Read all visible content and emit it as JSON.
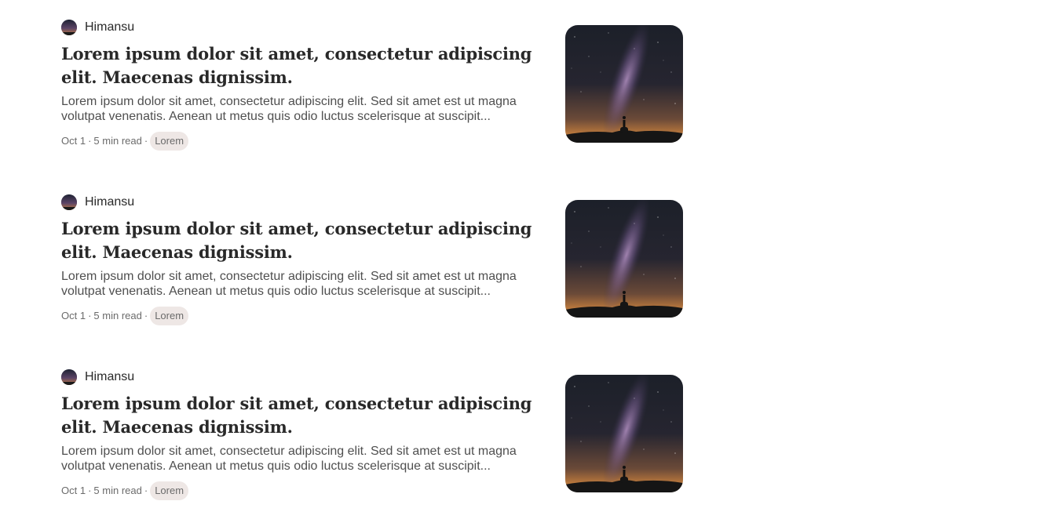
{
  "posts": [
    {
      "author": "Himansu",
      "title": "Lorem ipsum dolor sit amet, consectetur adipiscing elit. Maecenas dignissim.",
      "excerpt": "Lorem ipsum dolor sit amet, consectetur adipiscing elit. Sed sit amet est ut magna volutpat venenatis. Aenean ut metus quis odio luctus scelerisque at suscipit...",
      "date": "Oct 1",
      "read_time": "5 min read",
      "separator": "·",
      "tag": "Lorem",
      "thumbnail_icon": "milky-way-night-sky-image"
    },
    {
      "author": "Himansu",
      "title": "Lorem ipsum dolor sit amet, consectetur adipiscing elit. Maecenas dignissim.",
      "excerpt": "Lorem ipsum dolor sit amet, consectetur adipiscing elit. Sed sit amet est ut magna volutpat venenatis. Aenean ut metus quis odio luctus scelerisque at suscipit...",
      "date": "Oct 1",
      "read_time": "5 min read",
      "separator": "·",
      "tag": "Lorem",
      "thumbnail_icon": "milky-way-night-sky-image"
    },
    {
      "author": "Himansu",
      "title": "Lorem ipsum dolor sit amet, consectetur adipiscing elit. Maecenas dignissim.",
      "excerpt": "Lorem ipsum dolor sit amet, consectetur adipiscing elit. Sed sit amet est ut magna volutpat venenatis. Aenean ut metus quis odio luctus scelerisque at suscipit...",
      "date": "Oct 1",
      "read_time": "5 min read",
      "separator": "·",
      "tag": "Lorem",
      "thumbnail_icon": "milky-way-night-sky-image"
    }
  ],
  "colors": {
    "text": "#292929",
    "muted": "#6b6b6b",
    "excerpt": "#4f4f4f",
    "tag_bg": "#eee7e5",
    "background": "#ffffff"
  }
}
